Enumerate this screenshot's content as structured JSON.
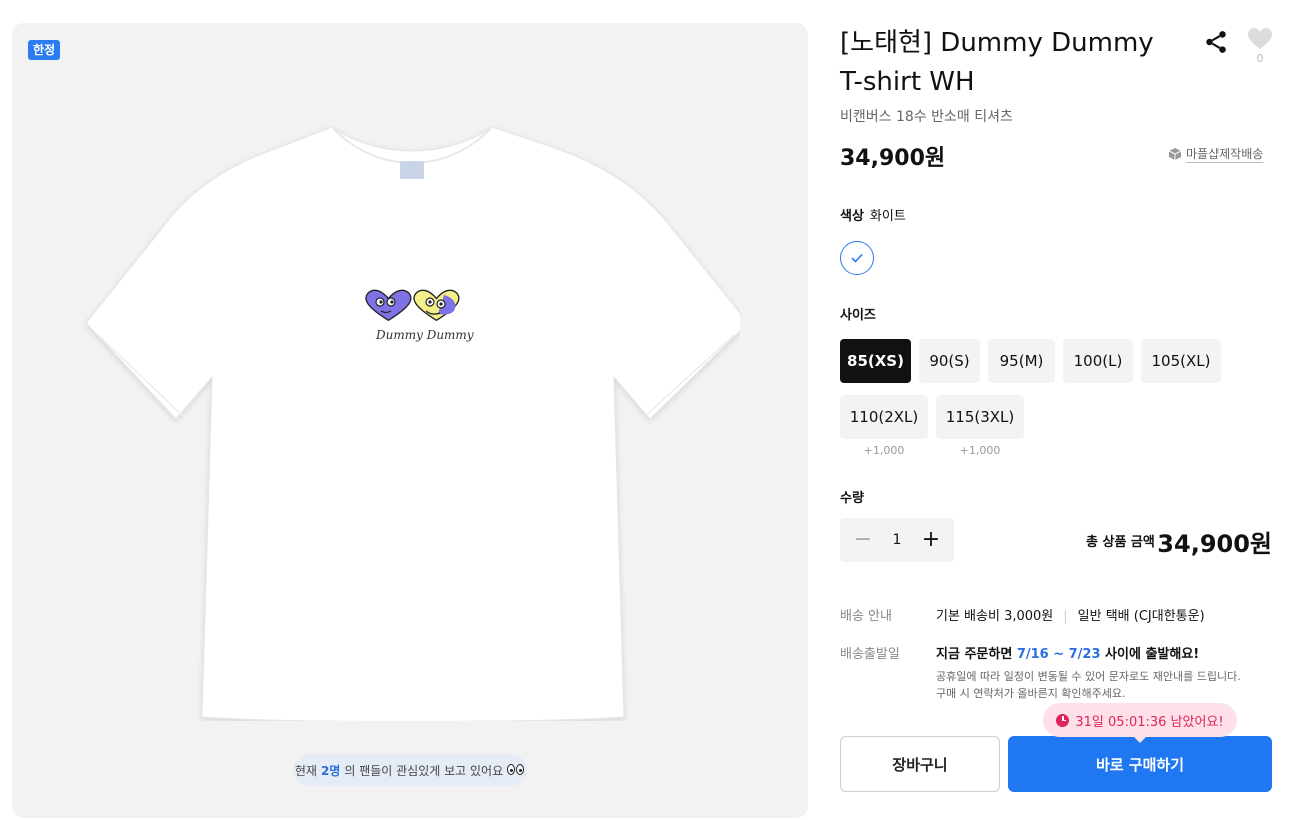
{
  "product": {
    "badge": "한정",
    "title": "[노태현] Dummy Dummy T-shirt WH",
    "subtitle": "비캔버스 18수 반소매 티셔츠",
    "price": "34,900원",
    "like_count": "0",
    "maker_link": "마플샵제작배송",
    "shirt_print": "Dummy Dummy",
    "viewers": {
      "prefix": "현재 ",
      "count": "2명",
      "suffix": "의 팬들이 관심있게 보고 있어요"
    }
  },
  "color": {
    "label": "색상",
    "value": "화이트"
  },
  "size": {
    "label": "사이즈",
    "options": [
      {
        "label": "85(XS)",
        "extra": ""
      },
      {
        "label": "90(S)",
        "extra": ""
      },
      {
        "label": "95(M)",
        "extra": ""
      },
      {
        "label": "100(L)",
        "extra": ""
      },
      {
        "label": "105(XL)",
        "extra": ""
      },
      {
        "label": "110(2XL)",
        "extra": "+1,000"
      },
      {
        "label": "115(3XL)",
        "extra": "+1,000"
      }
    ],
    "selected": "85(XS)"
  },
  "quantity": {
    "label": "수량",
    "value": "1",
    "minus": "−",
    "plus": "+"
  },
  "total": {
    "label": "총 상품 금액",
    "value": "34,900원"
  },
  "shipping": {
    "info_label": "배송 안내",
    "fee": "기본 배송비 3,000원",
    "separator": "|",
    "carrier": "일반 택배 (CJ대한통운)",
    "date_label": "배송출발일",
    "date_prefix": "지금 주문하면 ",
    "date_range": "7/16 ~ 7/23",
    "date_suffix": " 사이에 출발해요!",
    "note_line1": "공휴일에 따라 일정이 변동될 수 있어 문자로도 재안내를 드립니다.",
    "note_line2": "구매 시 연락처가 올바른지 확인해주세요."
  },
  "deadline": "31일 05:01:36 남았어요!",
  "buttons": {
    "cart": "장바구니",
    "buy": "바로 구매하기"
  },
  "colors": {
    "accent": "#1f78f2",
    "badge": "#2a7cf0",
    "deadline": "#e0245e",
    "selected_size": "#111111"
  }
}
